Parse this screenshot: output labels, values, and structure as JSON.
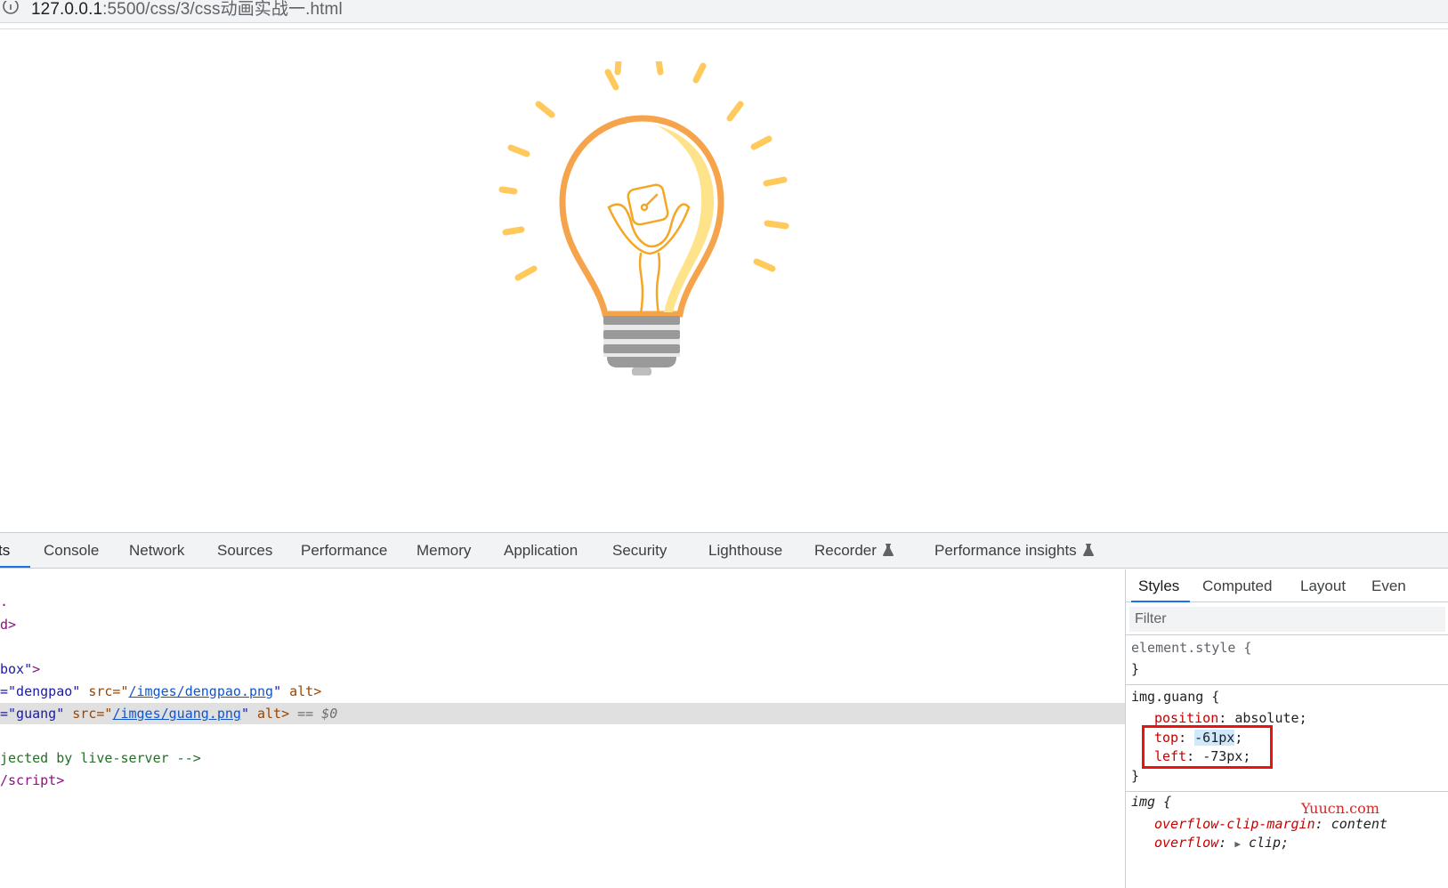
{
  "address_bar": {
    "host": "127.0.0.1",
    "path": ":5500/css/3/css动画实战一.html"
  },
  "devtools": {
    "tabs": [
      {
        "label": "ts",
        "active": true
      },
      {
        "label": "Console"
      },
      {
        "label": "Network"
      },
      {
        "label": "Sources"
      },
      {
        "label": "Performance"
      },
      {
        "label": "Memory"
      },
      {
        "label": "Application"
      },
      {
        "label": "Security"
      },
      {
        "label": "Lighthouse"
      },
      {
        "label": "Recorder"
      },
      {
        "label": "Performance insights"
      }
    ],
    "elements": {
      "line0": ".",
      "line1": "d>",
      "line2": "box\">",
      "img1": {
        "prefix": "=\"dengpao\"",
        "src_attr": " src=\"",
        "src": "/imges/dengpao.png",
        "end": "\"",
        "alt": " alt>"
      },
      "img2": {
        "prefix": "=\"guang\"",
        "src_attr": " src=\"",
        "src": "/imges/guang.png",
        "end": "\"",
        "alt": " alt>",
        "marker": " == $0"
      },
      "comment": "jected by live-server -->",
      "script_close": "/script>"
    },
    "styles": {
      "tabs": [
        "Styles",
        "Computed",
        "Layout",
        "Even"
      ],
      "filter_placeholder": "Filter",
      "element_style": "element.style {",
      "close_brace": "}",
      "rule1": {
        "selector": "img.guang {",
        "p1_name": "position",
        "p1_value": "absolute",
        "p2_name": "top",
        "p2_value": "-61px",
        "p3_name": "left",
        "p3_value": "-73px"
      },
      "rule2": {
        "selector": "img {",
        "p1_name": "overflow-clip-margin",
        "p1_value": "content",
        "p2_name": "overflow",
        "p2_value": "clip"
      }
    }
  },
  "watermark": "Yuucn.com"
}
